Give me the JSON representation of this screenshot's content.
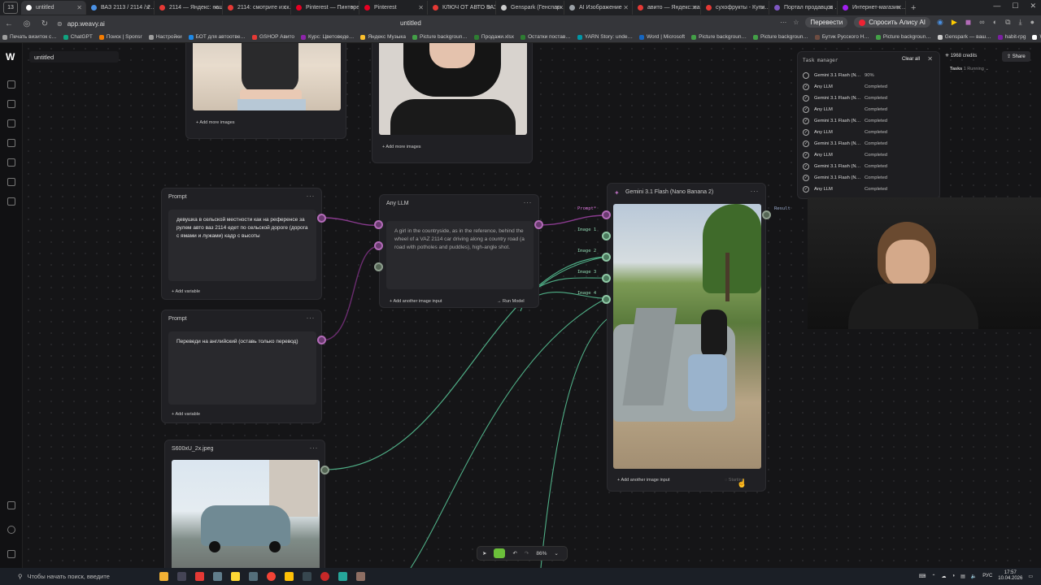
{
  "browser": {
    "tab_count": "13",
    "tabs": [
      {
        "label": "untitled",
        "color": "#ffffff",
        "active": true
      },
      {
        "label": "ВАЗ 2113 / 2114 / 2…",
        "color": "#4a90e2"
      },
      {
        "label": "2114 — Яндекс: нашл…",
        "color": "#e53935"
      },
      {
        "label": "2114: смотрите и ск…",
        "color": "#e53935"
      },
      {
        "label": "Pinterest — Пинтерест",
        "color": "#e60023"
      },
      {
        "label": "Pinterest",
        "color": "#e60023"
      },
      {
        "label": "КЛЮЧ ОТ АВТО ВАЗ",
        "color": "#e53935"
      },
      {
        "label": "Genspark (Генспарк…",
        "color": "#cccccc"
      },
      {
        "label": "AI Изображение",
        "color": "#9aa0a6"
      },
      {
        "label": "авито — Яндекс: на…",
        "color": "#e53935"
      },
      {
        "label": "сухофрукты - Купи…",
        "color": "#e53935"
      },
      {
        "label": "Портал продавцов …",
        "color": "#7e57c2"
      },
      {
        "label": "Интернет-магазин …",
        "color": "#a020f0"
      }
    ],
    "url": "app.weavy.ai",
    "center_title": "untitled",
    "translate_label": "Перевести",
    "alice_label": "Спросить Алису AI",
    "bookmarks": [
      {
        "label": "Печать визиток с…",
        "color": "#9e9e9e"
      },
      {
        "label": "ChatGPT",
        "color": "#10a37f"
      },
      {
        "label": "Поиск | Sponsr",
        "color": "#f57c00"
      },
      {
        "label": "Настройки",
        "color": "#9e9e9e"
      },
      {
        "label": "БОТ для автоотве…",
        "color": "#1e88e5"
      },
      {
        "label": "GSHOP Авито",
        "color": "#e53935"
      },
      {
        "label": "Курс: Цветоведе…",
        "color": "#8e24aa"
      },
      {
        "label": "Яндекс Музыка",
        "color": "#fbc02d"
      },
      {
        "label": "Picture backgroun…",
        "color": "#43a047"
      },
      {
        "label": "Продажи.xlsx",
        "color": "#2e7d32"
      },
      {
        "label": "Остатки постав…",
        "color": "#2e7d32"
      },
      {
        "label": "YARN Story: unde…",
        "color": "#0097a7"
      },
      {
        "label": "Word | Microsoft",
        "color": "#1565c0"
      },
      {
        "label": "Picture backgroun…",
        "color": "#43a047"
      },
      {
        "label": "Picture backgroun…",
        "color": "#43a047"
      },
      {
        "label": "Бутик Русского Н…",
        "color": "#6d4c41"
      },
      {
        "label": "Picture backgroun…",
        "color": "#43a047"
      },
      {
        "label": "Genspark — ваш…",
        "color": "#cccccc"
      },
      {
        "label": "habit-rpg",
        "color": "#7b1fa2"
      },
      {
        "label": "Wan…",
        "color": "#ffffff"
      }
    ]
  },
  "app": {
    "file_name": "untitled",
    "credits": "1968 credits",
    "share_label": "Share",
    "tasks_label": "Tasks",
    "tasks_running": "1 Running",
    "zoom": "86%"
  },
  "task_manager": {
    "title": "Task manager",
    "clear_label": "Clear all",
    "rows": [
      {
        "name": "Gemini 3.1 Flash (N…",
        "status": "90%"
      },
      {
        "name": "Any LLM",
        "status": "Completed"
      },
      {
        "name": "Gemini 3.1 Flash (N…",
        "status": "Completed"
      },
      {
        "name": "Any LLM",
        "status": "Completed"
      },
      {
        "name": "Gemini 3.1 Flash (N…",
        "status": "Completed"
      },
      {
        "name": "Any LLM",
        "status": "Completed"
      },
      {
        "name": "Gemini 3.1 Flash (N…",
        "status": "Completed"
      },
      {
        "name": "Any LLM",
        "status": "Completed"
      },
      {
        "name": "Gemini 3.1 Flash (N…",
        "status": "Completed"
      },
      {
        "name": "Gemini 3.1 Flash (N…",
        "status": "Completed"
      },
      {
        "name": "Any LLM",
        "status": "Completed"
      }
    ]
  },
  "nodes": {
    "top_left_add": "+ Add more images",
    "top_mid_add": "+ Add more images",
    "prompt1": {
      "title": "Prompt",
      "text": "девушка в сельской местности как на референсе за рулем авто ваз 2114 едет по сельской дороге (дорога с ямами и лужами) кадр с высоты",
      "add_variable": "Add variable"
    },
    "prompt2": {
      "title": "Prompt",
      "text": "Переведи на английский (оставь только перевод)",
      "add_variable": "Add variable"
    },
    "llm": {
      "title": "Any LLM",
      "text": "A girl in the countryside, as in the reference, behind the wheel of a VAZ 2114 car driving along a country road (a road with potholes and puddles), high-angle shot.",
      "add_image": "Add another image input",
      "run": "Run Model"
    },
    "gemini": {
      "title": "Gemini 3.1 Flash (Nano Banana 2)",
      "inputs": [
        "Prompt*",
        "Image 1",
        "Image 2",
        "Image 3",
        "Image 4"
      ],
      "result": "Result",
      "add_image": "Add another image input",
      "status": "Starting"
    },
    "image_file": {
      "title": "S600xU_2x.jpeg"
    }
  },
  "taskbar": {
    "search_placeholder": "Чтобы начать поиск, введите",
    "lang": "РУС",
    "time": "17:57",
    "date": "10.04.2026"
  }
}
